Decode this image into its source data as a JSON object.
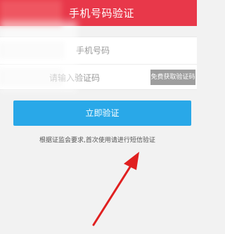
{
  "header": {
    "title": "手机号码验证",
    "background_color": "#e8384a"
  },
  "form": {
    "phone_placeholder": "手机号码",
    "code_placeholder": "请输入验证码",
    "send_code_label": "免费获取验证码"
  },
  "actions": {
    "verify_label": "立即验证",
    "verify_color": "#29a8e8"
  },
  "notice": {
    "text": "根据证监会要求,首次使用请进行短信验证"
  },
  "annotation": {
    "arrow_color": "#e02020"
  }
}
